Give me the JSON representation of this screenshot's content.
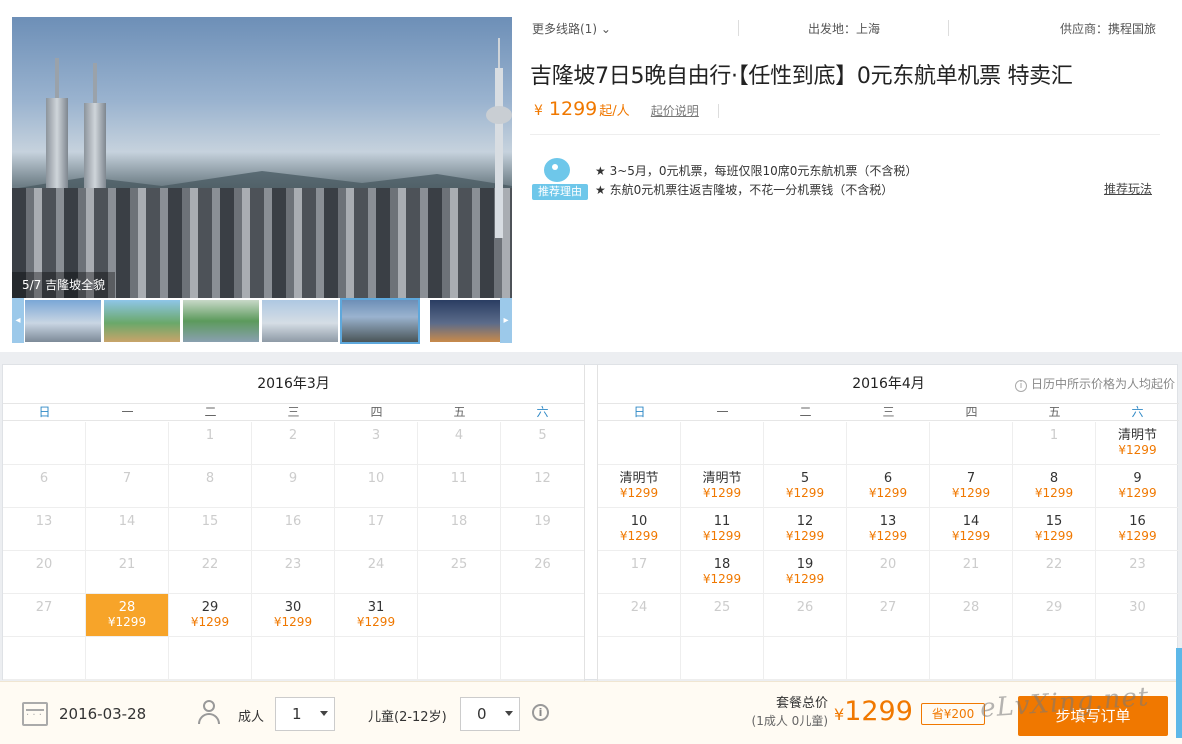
{
  "gallery": {
    "caption": "5/7 吉隆坡全貌",
    "thumbs": [
      "thumb-1",
      "thumb-2",
      "thumb-3",
      "thumb-4",
      "thumb-5",
      "thumb-6"
    ],
    "prev_icon": "◂",
    "next_icon": "▸"
  },
  "meta": {
    "more_routes": "更多线路(1)",
    "departure": "出发地：上海",
    "supplier": "供应商：携程国旅"
  },
  "product": {
    "title": "吉隆坡7日5晚自由行·【任性到底】0元东航单机票 特卖汇",
    "currency": "¥",
    "price": "1299",
    "price_unit": "起/人",
    "price_explain": "起价说明"
  },
  "recommend": {
    "badge": "推荐理由",
    "lines": [
      "★ 3~5月，0元机票，每班仅限10席0元东航机票（不含税）",
      "★ 东航0元机票往返吉隆坡，不花一分机票钱（不含税）"
    ],
    "link": "推荐玩法"
  },
  "calendar": {
    "note": "日历中所示价格为人均起价",
    "weekdays": [
      "日",
      "一",
      "二",
      "三",
      "四",
      "五",
      "六"
    ],
    "months": [
      {
        "title": "2016年3月",
        "rows": [
          [
            {
              "d": ""
            },
            {
              "d": ""
            },
            {
              "d": "1"
            },
            {
              "d": "2"
            },
            {
              "d": "3"
            },
            {
              "d": "4"
            },
            {
              "d": "5"
            }
          ],
          [
            {
              "d": "6"
            },
            {
              "d": "7"
            },
            {
              "d": "8"
            },
            {
              "d": "9"
            },
            {
              "d": "10"
            },
            {
              "d": "11"
            },
            {
              "d": "12"
            }
          ],
          [
            {
              "d": "13"
            },
            {
              "d": "14"
            },
            {
              "d": "15"
            },
            {
              "d": "16"
            },
            {
              "d": "17"
            },
            {
              "d": "18"
            },
            {
              "d": "19"
            }
          ],
          [
            {
              "d": "20"
            },
            {
              "d": "21"
            },
            {
              "d": "22"
            },
            {
              "d": "23"
            },
            {
              "d": "24"
            },
            {
              "d": "25"
            },
            {
              "d": "26"
            }
          ],
          [
            {
              "d": "27"
            },
            {
              "d": "28",
              "p": "¥1299",
              "sel": true
            },
            {
              "d": "29",
              "p": "¥1299"
            },
            {
              "d": "30",
              "p": "¥1299"
            },
            {
              "d": "31",
              "p": "¥1299"
            },
            {
              "d": ""
            },
            {
              "d": ""
            }
          ],
          [
            {
              "d": ""
            },
            {
              "d": ""
            },
            {
              "d": ""
            },
            {
              "d": ""
            },
            {
              "d": ""
            },
            {
              "d": ""
            },
            {
              "d": ""
            }
          ]
        ]
      },
      {
        "title": "2016年4月",
        "rows": [
          [
            {
              "d": ""
            },
            {
              "d": ""
            },
            {
              "d": ""
            },
            {
              "d": ""
            },
            {
              "d": ""
            },
            {
              "d": "1"
            },
            {
              "d": "清明节",
              "p": "¥1299"
            }
          ],
          [
            {
              "d": "清明节",
              "p": "¥1299"
            },
            {
              "d": "清明节",
              "p": "¥1299"
            },
            {
              "d": "5",
              "p": "¥1299"
            },
            {
              "d": "6",
              "p": "¥1299"
            },
            {
              "d": "7",
              "p": "¥1299"
            },
            {
              "d": "8",
              "p": "¥1299"
            },
            {
              "d": "9",
              "p": "¥1299"
            }
          ],
          [
            {
              "d": "10",
              "p": "¥1299"
            },
            {
              "d": "11",
              "p": "¥1299"
            },
            {
              "d": "12",
              "p": "¥1299"
            },
            {
              "d": "13",
              "p": "¥1299"
            },
            {
              "d": "14",
              "p": "¥1299"
            },
            {
              "d": "15",
              "p": "¥1299"
            },
            {
              "d": "16",
              "p": "¥1299"
            }
          ],
          [
            {
              "d": "17"
            },
            {
              "d": "18",
              "p": "¥1299"
            },
            {
              "d": "19",
              "p": "¥1299"
            },
            {
              "d": "20"
            },
            {
              "d": "21"
            },
            {
              "d": "22"
            },
            {
              "d": "23"
            }
          ],
          [
            {
              "d": "24"
            },
            {
              "d": "25"
            },
            {
              "d": "26"
            },
            {
              "d": "27"
            },
            {
              "d": "28"
            },
            {
              "d": "29"
            },
            {
              "d": "30"
            }
          ],
          [
            {
              "d": ""
            },
            {
              "d": ""
            },
            {
              "d": ""
            },
            {
              "d": ""
            },
            {
              "d": ""
            },
            {
              "d": ""
            },
            {
              "d": ""
            }
          ]
        ]
      }
    ]
  },
  "booking": {
    "date": "2016-03-28",
    "adult_label": "成人",
    "adult_value": "1",
    "child_label": "儿童(2-12岁)",
    "child_value": "0",
    "total_label": "套餐总价",
    "total_sub": "(1成人 0儿童)",
    "currency": "¥",
    "total": "1299",
    "save": "省¥200",
    "order_button": "步填写订单",
    "watermark": "eLvXing.net"
  },
  "colors": {
    "accent": "#f07800",
    "selected": "#f7a429",
    "weekend": "#2f89c6"
  }
}
